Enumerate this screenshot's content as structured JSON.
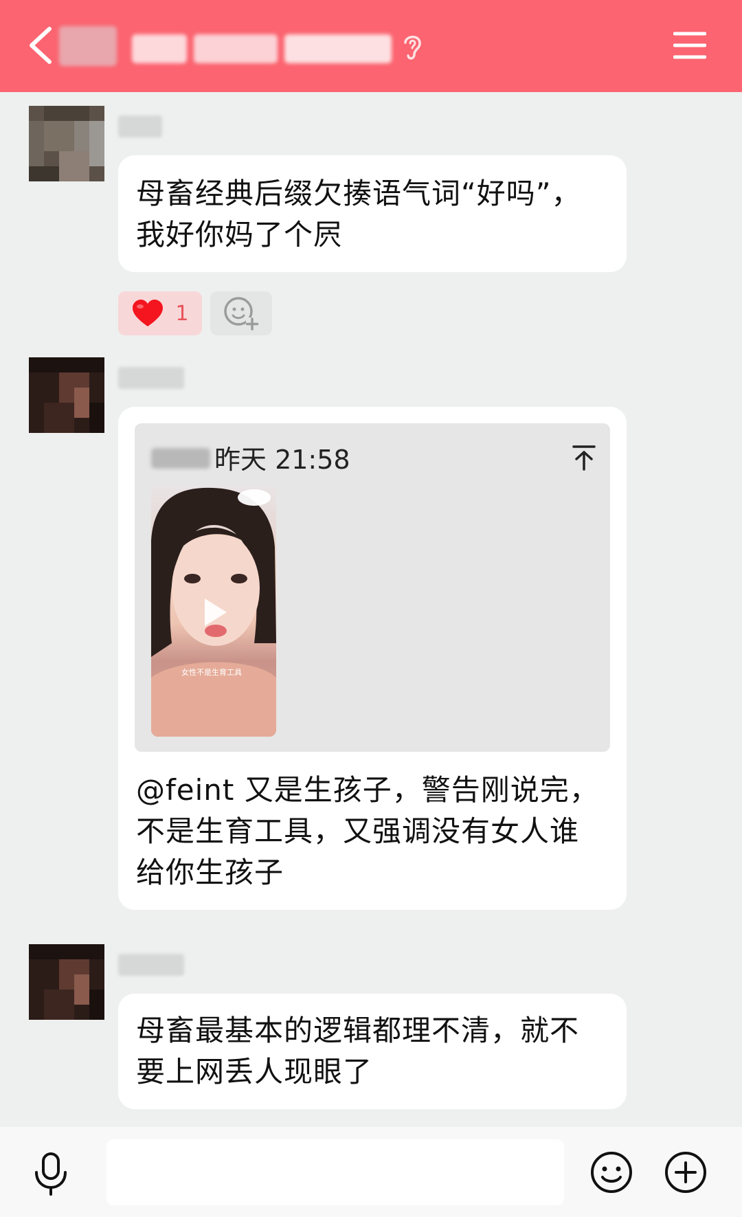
{
  "header": {
    "back_icon": "chevron-left-icon",
    "title_obscured": true,
    "ear_icon": "ear-icon",
    "menu_icon": "hamburger-menu-icon",
    "background": "#fb6470"
  },
  "messages": [
    {
      "sender_obscured": true,
      "text_line1": "母畜经典后缀欠揍语气词“好吗”，",
      "text_line2": "我好你妈了个屄",
      "reaction_count": "1",
      "reaction_icon": "heart-icon",
      "add_reaction_icon": "add-emoji-icon"
    },
    {
      "sender_obscured": true,
      "quote": {
        "time": "昨天 21:58",
        "scroll_top_icon": "scroll-to-top-icon",
        "video_caption": "女性不是生育工具"
      },
      "text_line1": "@feint 又是生孩子，警告刚说完，",
      "text_line2": "不是生育工具，又强调没有女人谁",
      "text_line3": "给你生孩子"
    },
    {
      "sender_obscured": true,
      "text_line1": "母畜最基本的逻辑都理不清，就不",
      "text_line2": "要上网丢人现眼了"
    }
  ],
  "footer": {
    "mic_icon": "microphone-icon",
    "emoji_icon": "emoji-icon",
    "plus_icon": "plus-circle-icon",
    "input_value": ""
  }
}
